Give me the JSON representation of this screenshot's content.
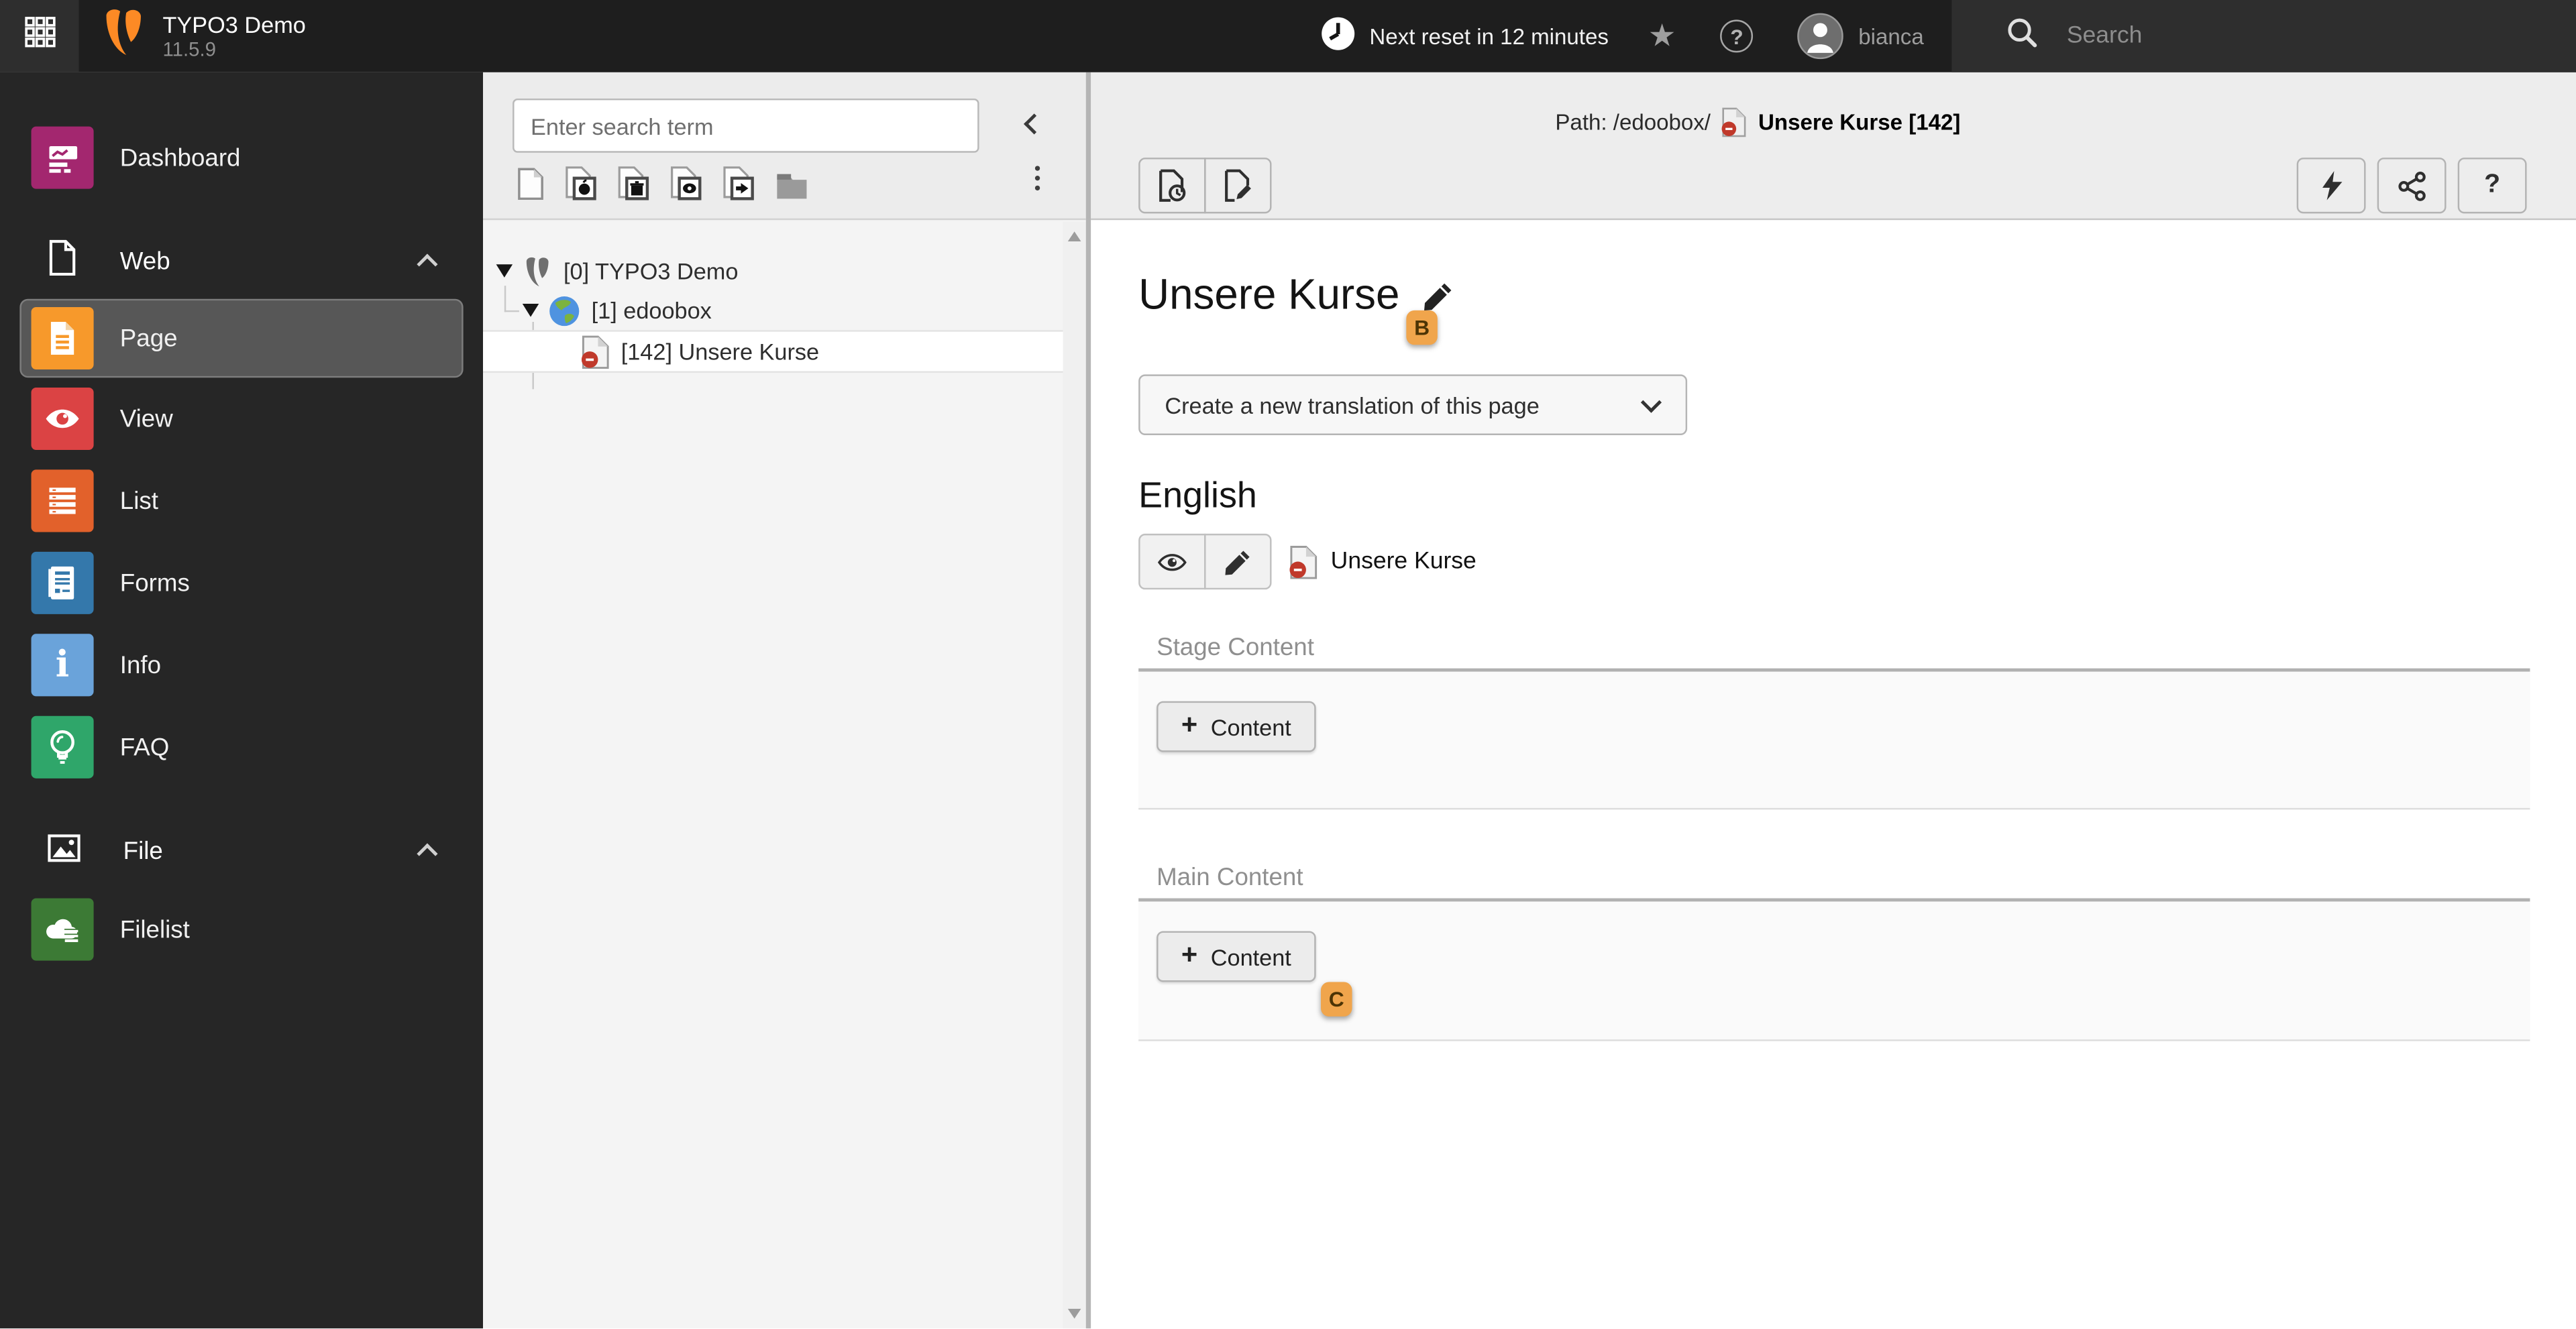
{
  "topbar": {
    "product_name": "TYPO3 Demo",
    "version": "11.5.9",
    "reset_notice": "Next reset in 12 minutes",
    "username": "bianca",
    "search_placeholder": "Search",
    "icons": [
      "modulemenu-grid-icon",
      "typo3-logo",
      "clock-icon",
      "star-icon",
      "help-icon",
      "avatar",
      "search-icon"
    ]
  },
  "sidebar": {
    "items": [
      {
        "label": "Dashboard",
        "color": "#a3276f",
        "icon": "dashboard-icon"
      },
      {
        "label": "Web",
        "type": "section",
        "icon": "page-outline-icon"
      },
      {
        "label": "Page",
        "color": "#f7992b",
        "icon": "page-icon",
        "active": true
      },
      {
        "label": "View",
        "color": "#db4344",
        "icon": "eye-icon"
      },
      {
        "label": "List",
        "color": "#e2612b",
        "icon": "list-icon"
      },
      {
        "label": "Forms",
        "color": "#3478ab",
        "icon": "form-icon"
      },
      {
        "label": "Info",
        "color": "#6aa3da",
        "icon": "info-icon"
      },
      {
        "label": "FAQ",
        "color": "#2fa66a",
        "icon": "lightbulb-icon"
      },
      {
        "label": "File",
        "type": "section",
        "icon": "image-outline-icon"
      },
      {
        "label": "Filelist",
        "color": "#3c7a35",
        "icon": "cloud-list-icon"
      }
    ]
  },
  "tree": {
    "search_placeholder": "Enter search term",
    "toolbar_icons": [
      "new-page",
      "new-backend-section",
      "new-recycler",
      "new-mount-point",
      "new-shortcut",
      "new-folder",
      "kebab-menu"
    ],
    "nodes": [
      {
        "label": "[0] TYPO3 Demo",
        "icon": "typo3-logo-gray"
      },
      {
        "label": "[1] edoobox",
        "icon": "globe-icon"
      },
      {
        "label": "[142] Unsere Kurse",
        "icon": "page-hidden-icon",
        "selected": true
      }
    ]
  },
  "docheader": {
    "path_prefix": "Path: /edoobox/",
    "record": "Unsere Kurse [142]",
    "left_buttons": [
      "page-history",
      "edit-page-properties"
    ],
    "right_buttons": [
      "clear-cache",
      "share",
      "help"
    ]
  },
  "content": {
    "page_title": "Unsere Kurse",
    "translation_button": "Create a new translation of this page",
    "language_heading": "English",
    "record_name": "Unsere Kurse",
    "sections": [
      {
        "title": "Stage Content",
        "button": "Content"
      },
      {
        "title": "Main Content",
        "button": "Content"
      }
    ]
  },
  "annotations": {
    "badge_b": "B",
    "badge_c": "C",
    "badge_color": "#f0a54c"
  }
}
